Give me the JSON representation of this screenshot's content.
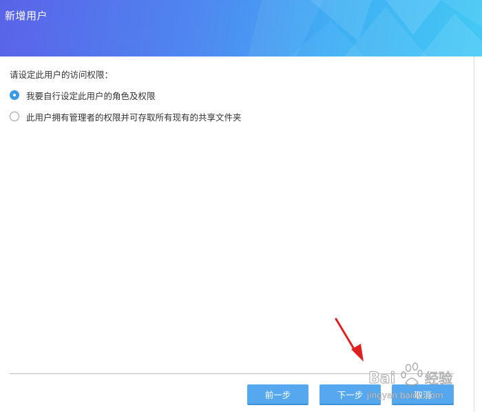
{
  "dialog": {
    "title": "新增用户"
  },
  "permissions": {
    "prompt": "请设定此用户的访问权限：",
    "options": [
      {
        "label": "我要自行设定此用户的角色及权限",
        "selected": true
      },
      {
        "label": "此用户拥有管理者的权限并可存取所有现有的共享文件夹",
        "selected": false
      }
    ]
  },
  "footer": {
    "prev_label": "前一步",
    "next_label": "下一步",
    "cancel_label": "取消"
  },
  "watermark": {
    "brand": "Baidu 经验",
    "url": "jingyan.baidu.com"
  },
  "colors": {
    "button": "#56a8ee",
    "radio_checked": "#3b9ae8",
    "annotation_arrow": "#e02020"
  },
  "icons": {
    "arrow": "red-annotation-arrow",
    "watermark": "baidu-paw-logo"
  }
}
